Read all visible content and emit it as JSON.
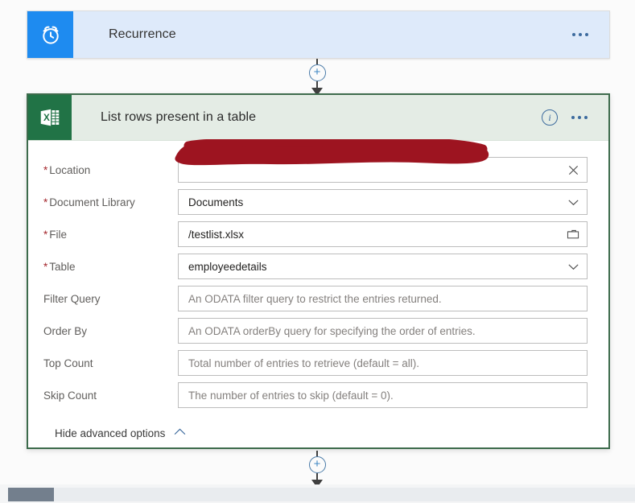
{
  "flow": {
    "trigger": {
      "title": "Recurrence",
      "icon": "alarm-clock-icon",
      "icon_bg": "#1e8bf0",
      "header_bg": "#deeafa",
      "menu_label": "•••"
    },
    "action": {
      "title": "List rows present in a table",
      "icon": "excel-icon",
      "icon_bg": "#217346",
      "header_bg": "#e4ece5",
      "border_color": "#3d6b4c",
      "info_label": "i",
      "menu_label": "•••",
      "fields": [
        {
          "label": "Location",
          "required": true,
          "value": "",
          "placeholder": "",
          "redacted": true,
          "control": "combo",
          "trailing_icon": "close-icon"
        },
        {
          "label": "Document Library",
          "required": true,
          "value": "Documents",
          "placeholder": "",
          "redacted": false,
          "control": "dropdown",
          "trailing_icon": "chevron-down-icon"
        },
        {
          "label": "File",
          "required": true,
          "value": "/testlist.xlsx",
          "placeholder": "",
          "redacted": false,
          "control": "filepicker",
          "trailing_icon": "folder-icon"
        },
        {
          "label": "Table",
          "required": true,
          "value": "employeedetails",
          "placeholder": "",
          "redacted": false,
          "control": "dropdown",
          "trailing_icon": "chevron-down-icon"
        },
        {
          "label": "Filter Query",
          "required": false,
          "value": "",
          "placeholder": "An ODATA filter query to restrict the entries returned.",
          "redacted": false,
          "control": "text",
          "trailing_icon": ""
        },
        {
          "label": "Order By",
          "required": false,
          "value": "",
          "placeholder": "An ODATA orderBy query for specifying the order of entries.",
          "redacted": false,
          "control": "text",
          "trailing_icon": ""
        },
        {
          "label": "Top Count",
          "required": false,
          "value": "",
          "placeholder": "Total number of entries to retrieve (default = all).",
          "redacted": false,
          "control": "text",
          "trailing_icon": ""
        },
        {
          "label": "Skip Count",
          "required": false,
          "value": "",
          "placeholder": "The number of entries to skip (default = 0).",
          "redacted": false,
          "control": "text",
          "trailing_icon": ""
        }
      ],
      "advanced_options_label": "Hide advanced options",
      "advanced_options_icon": "chevron-up-icon"
    },
    "connectors": [
      {
        "add_label": "+",
        "icon": "add-step-icon"
      },
      {
        "add_label": "+",
        "icon": "add-step-icon"
      }
    ]
  },
  "colors": {
    "redaction": "#9d1420",
    "excel_green": "#217346",
    "trigger_blue": "#1e8bf0",
    "required_asterisk": "#a4262c",
    "scrollbar_thumb": "#737f8d"
  }
}
